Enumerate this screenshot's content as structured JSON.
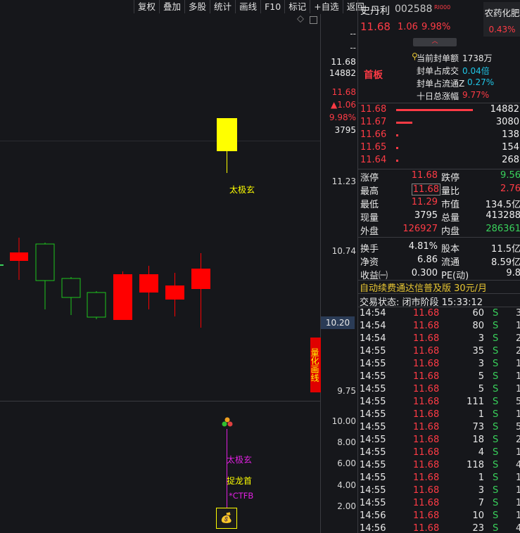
{
  "toolbar": [
    "复权",
    "叠加",
    "多股",
    "统计",
    "画线",
    "F10",
    "标记",
    "+自选",
    "返回"
  ],
  "chart": {
    "right_axis_top": [
      "--",
      "--"
    ],
    "price_labels": {
      "current": "11.68",
      "volume_top": "14882",
      "price_red": "11.68",
      "change": "▲1.06",
      "pct": "9.98%",
      "vol": "3795"
    },
    "price_ticks": [
      "11.23",
      "10.74",
      "10.20",
      "9.75"
    ],
    "indicator_ticks": [
      "10.00",
      "8.00",
      "6.00",
      "4.00",
      "2.00"
    ],
    "annotation_main": "太极玄",
    "annotation_sub1": "太极玄",
    "annotation_sub2": "捉龙首",
    "annotation_sub3": "*CTFB",
    "quant_label": "量化画线",
    "colors": {
      "up": "#ff0000",
      "down": "#1ec51e",
      "highlight": "#ffff00",
      "magenta": "#e020e0"
    }
  },
  "header": {
    "name": "史丹利",
    "code": "002588",
    "badge": "RI000",
    "price": "11.68",
    "change": "1.06",
    "pct": "9.98%",
    "sector": "农药化肥",
    "sector_pct": "0.43%"
  },
  "seal": {
    "tag": "首板",
    "rows": [
      {
        "label": "当前封单额",
        "value": "1738万"
      },
      {
        "label": "封单占成交",
        "value": "0.04倍"
      },
      {
        "label": "封单占流通Z",
        "value": "0.27%"
      },
      {
        "label": "十日总涨幅",
        "value": "9.77%"
      }
    ]
  },
  "orderbook": [
    {
      "price": "11.68",
      "vol": "14882",
      "bar": 1.0
    },
    {
      "price": "11.67",
      "vol": "3080",
      "bar": 0.21
    },
    {
      "price": "11.66",
      "vol": "138",
      "bar": 0.02
    },
    {
      "price": "11.65",
      "vol": "154",
      "bar": 0.02
    },
    {
      "price": "11.64",
      "vol": "268",
      "bar": 0.02
    }
  ],
  "quote": [
    {
      "l1": "涨停",
      "v1": "11.68",
      "c1": "red",
      "l2": "跌停",
      "v2": "9.56",
      "c2": "green"
    },
    {
      "l1": "最高",
      "v1": "11.68",
      "c1": "red",
      "l2": "量比",
      "v2": "2.76",
      "c2": "red"
    },
    {
      "l1": "最低",
      "v1": "11.29",
      "c1": "red",
      "l2": "市值",
      "v2": "134.5亿",
      "c2": "white"
    },
    {
      "l1": "现量",
      "v1": "3795",
      "c1": "white",
      "l2": "总量",
      "v2": "413288",
      "c2": "white"
    },
    {
      "l1": "外盘",
      "v1": "126927",
      "c1": "red",
      "l2": "内盘",
      "v2": "286361",
      "c2": "green"
    },
    {
      "l1": "换手",
      "v1": "4.81%",
      "c1": "white",
      "l2": "股本",
      "v2": "11.5亿",
      "c2": "white"
    },
    {
      "l1": "净资",
      "v1": "6.86",
      "c1": "white",
      "l2": "流通",
      "v2": "8.59亿",
      "c2": "white"
    },
    {
      "l1": "收益㈠",
      "v1": "0.300",
      "c1": "white",
      "l2": "PE(动)",
      "v2": "9.8",
      "c2": "white"
    }
  ],
  "promo": "自动续费通达信普及版 30元/月",
  "trade_status": "交易状态: 闭市阶段 15:33:12",
  "ticks": [
    {
      "t": "14:54",
      "p": "11.68",
      "v": "60",
      "f": "S",
      "x": "3"
    },
    {
      "t": "14:54",
      "p": "11.68",
      "v": "80",
      "f": "S",
      "x": "1"
    },
    {
      "t": "14:54",
      "p": "11.68",
      "v": "3",
      "f": "S",
      "x": "2"
    },
    {
      "t": "14:55",
      "p": "11.68",
      "v": "35",
      "f": "S",
      "x": "2"
    },
    {
      "t": "14:55",
      "p": "11.68",
      "v": "3",
      "f": "S",
      "x": "1"
    },
    {
      "t": "14:55",
      "p": "11.68",
      "v": "5",
      "f": "S",
      "x": "1"
    },
    {
      "t": "14:55",
      "p": "11.68",
      "v": "5",
      "f": "S",
      "x": "1"
    },
    {
      "t": "14:55",
      "p": "11.68",
      "v": "111",
      "f": "S",
      "x": "5"
    },
    {
      "t": "14:55",
      "p": "11.68",
      "v": "1",
      "f": "S",
      "x": "1"
    },
    {
      "t": "14:55",
      "p": "11.68",
      "v": "73",
      "f": "S",
      "x": "5"
    },
    {
      "t": "14:55",
      "p": "11.68",
      "v": "18",
      "f": "S",
      "x": "2"
    },
    {
      "t": "14:55",
      "p": "11.68",
      "v": "4",
      "f": "S",
      "x": "1"
    },
    {
      "t": "14:55",
      "p": "11.68",
      "v": "118",
      "f": "S",
      "x": "4"
    },
    {
      "t": "14:55",
      "p": "11.68",
      "v": "1",
      "f": "S",
      "x": "1"
    },
    {
      "t": "14:55",
      "p": "11.68",
      "v": "3",
      "f": "S",
      "x": "1"
    },
    {
      "t": "14:55",
      "p": "11.68",
      "v": "7",
      "f": "S",
      "x": "1"
    },
    {
      "t": "14:56",
      "p": "11.68",
      "v": "10",
      "f": "S",
      "x": "1"
    },
    {
      "t": "14:56",
      "p": "11.68",
      "v": "23",
      "f": "S",
      "x": "4"
    }
  ]
}
